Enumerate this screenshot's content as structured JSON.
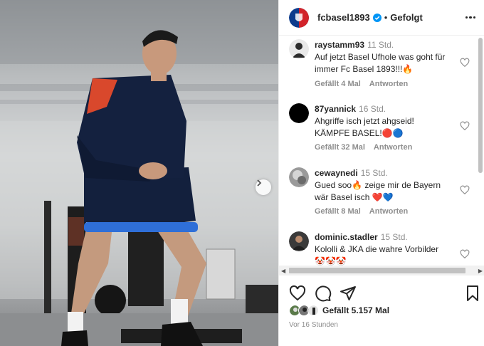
{
  "post": {
    "username": "fcbasel1893",
    "separator": "•",
    "follow_label": "Gefolgt",
    "likes_label": "Gefällt 5.157 Mal",
    "age_label": "Vor 16 Stunden"
  },
  "comments": [
    {
      "user": "raystamm93",
      "time": "11 Std.",
      "text": "Auf jetzt Basel Ufhole was goht für immer Fc Basel 1893!!!🔥",
      "likes": "Gefällt 4 Mal",
      "reply": "Antworten"
    },
    {
      "user": "87yannick",
      "time": "16 Std.",
      "text": "Ahgriffe isch jetzt ahgseid! KÄMPFE BASEL!🔴🔵",
      "likes": "Gefällt 32 Mal",
      "reply": "Antworten"
    },
    {
      "user": "cewaynedi",
      "time": "15 Std.",
      "text": "Gued soo🔥 zeige mir de Bayern wär Basel isch ❤️💙",
      "likes": "Gefällt 8 Mal",
      "reply": "Antworten"
    },
    {
      "user": "dominic.stadler",
      "time": "15 Std.",
      "text": "Kololli & JKA die wahre Vorbilder 🤡🤡🤡"
    }
  ],
  "colors": {
    "verified_blue": "#0095f6",
    "club_red": "#d2232a",
    "club_blue": "#0d3b8c"
  }
}
